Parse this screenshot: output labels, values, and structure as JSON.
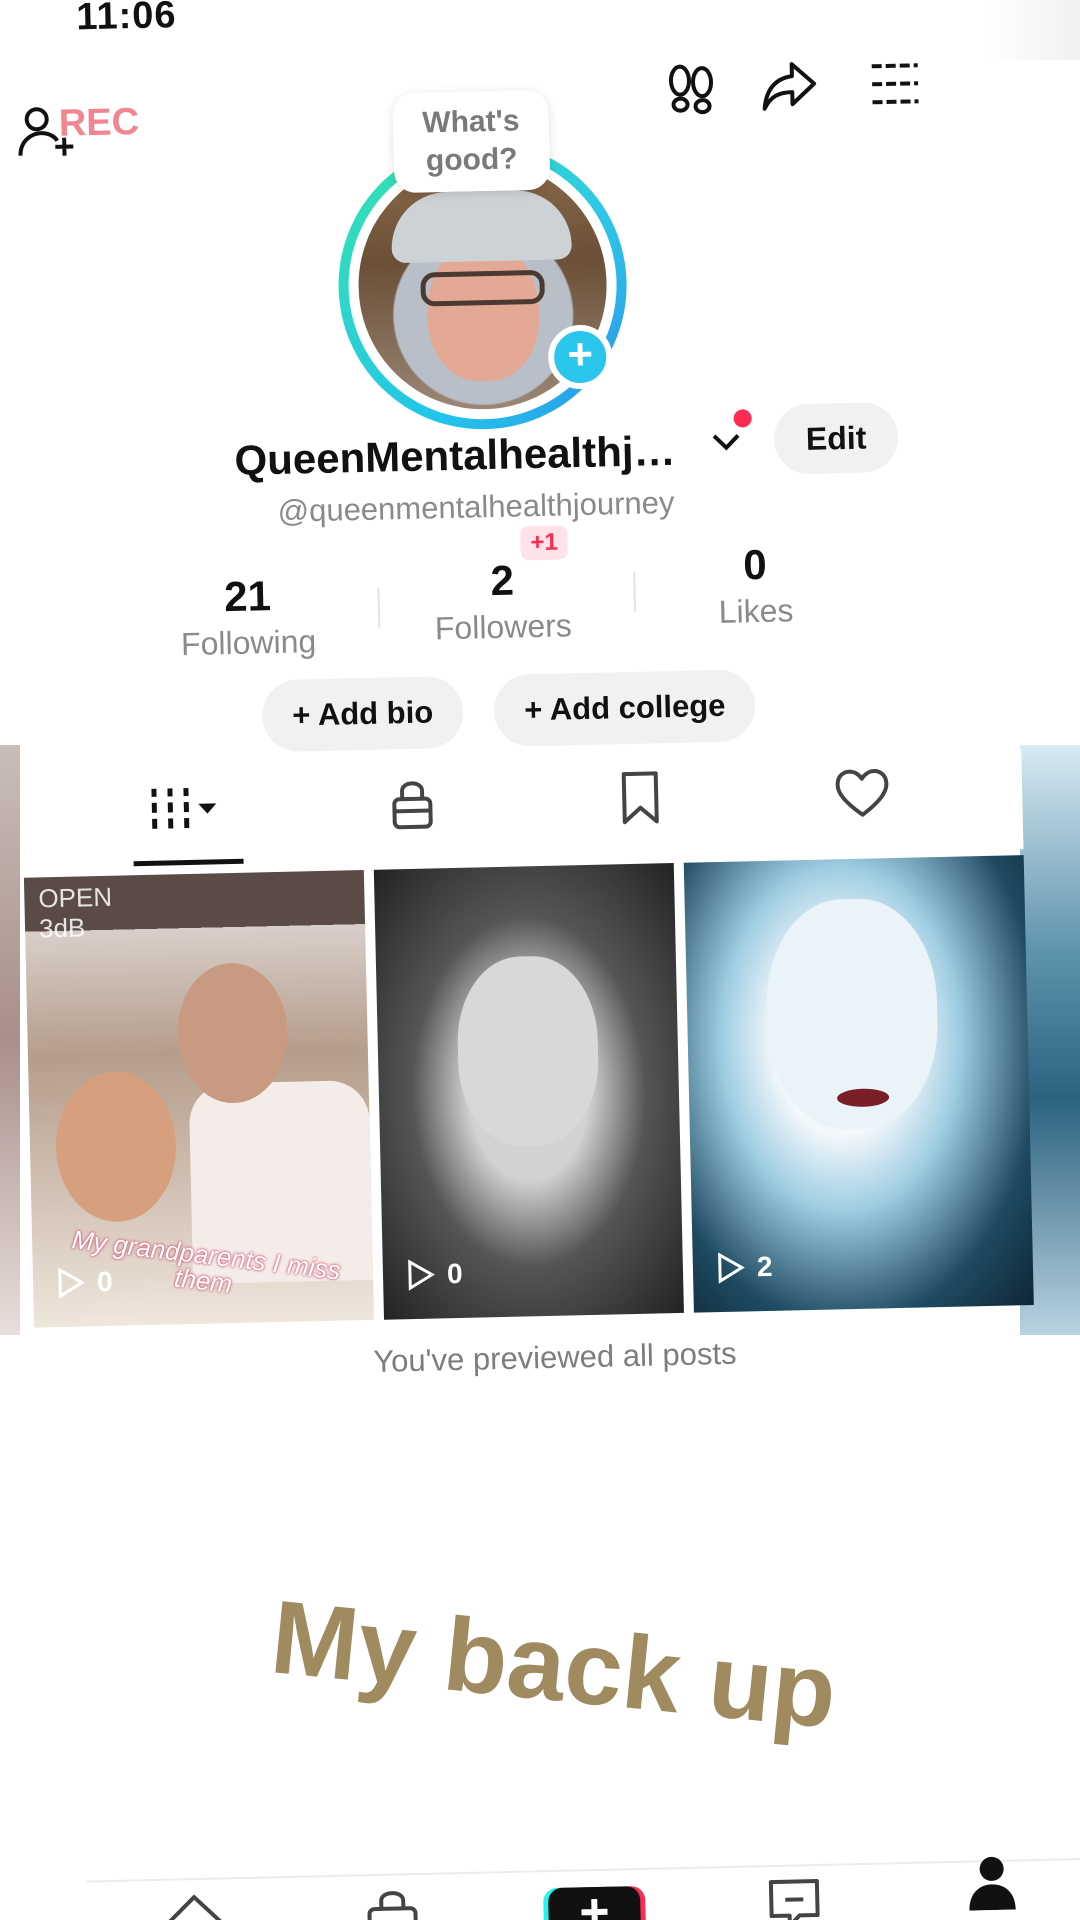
{
  "status_bar": {
    "time": "11:06"
  },
  "top_bar": {
    "rec_label": "REC"
  },
  "profile": {
    "bubble_text": "What's good?",
    "display_name": "QueenMentalhealthj…",
    "handle": "@queenmentalhealthjourney",
    "edit_label": "Edit"
  },
  "stats": {
    "following": {
      "value": "21",
      "label": "Following"
    },
    "followers": {
      "value": "2",
      "label": "Followers",
      "badge": "+1"
    },
    "likes": {
      "value": "0",
      "label": "Likes"
    }
  },
  "actions": {
    "add_bio": "+ Add bio",
    "add_college": "+ Add college"
  },
  "tabs": [
    "videos",
    "private",
    "favorites",
    "liked"
  ],
  "videos": [
    {
      "overlay_top": "OPEN\n3dB",
      "caption": "My grandparents I miss them",
      "views": "0"
    },
    {
      "views": "0"
    },
    {
      "views": "2"
    }
  ],
  "footer_note": "You've previewed all posts",
  "overlay_caption": "My back up",
  "colors": {
    "accent": "#fe2c55",
    "ring": "#22c4ea",
    "rec": "#f07a86",
    "overlay_text": "#a08a5f"
  },
  "bottom_nav": [
    "home-icon",
    "shop-icon",
    "create-button",
    "inbox-icon",
    "profile-icon"
  ]
}
